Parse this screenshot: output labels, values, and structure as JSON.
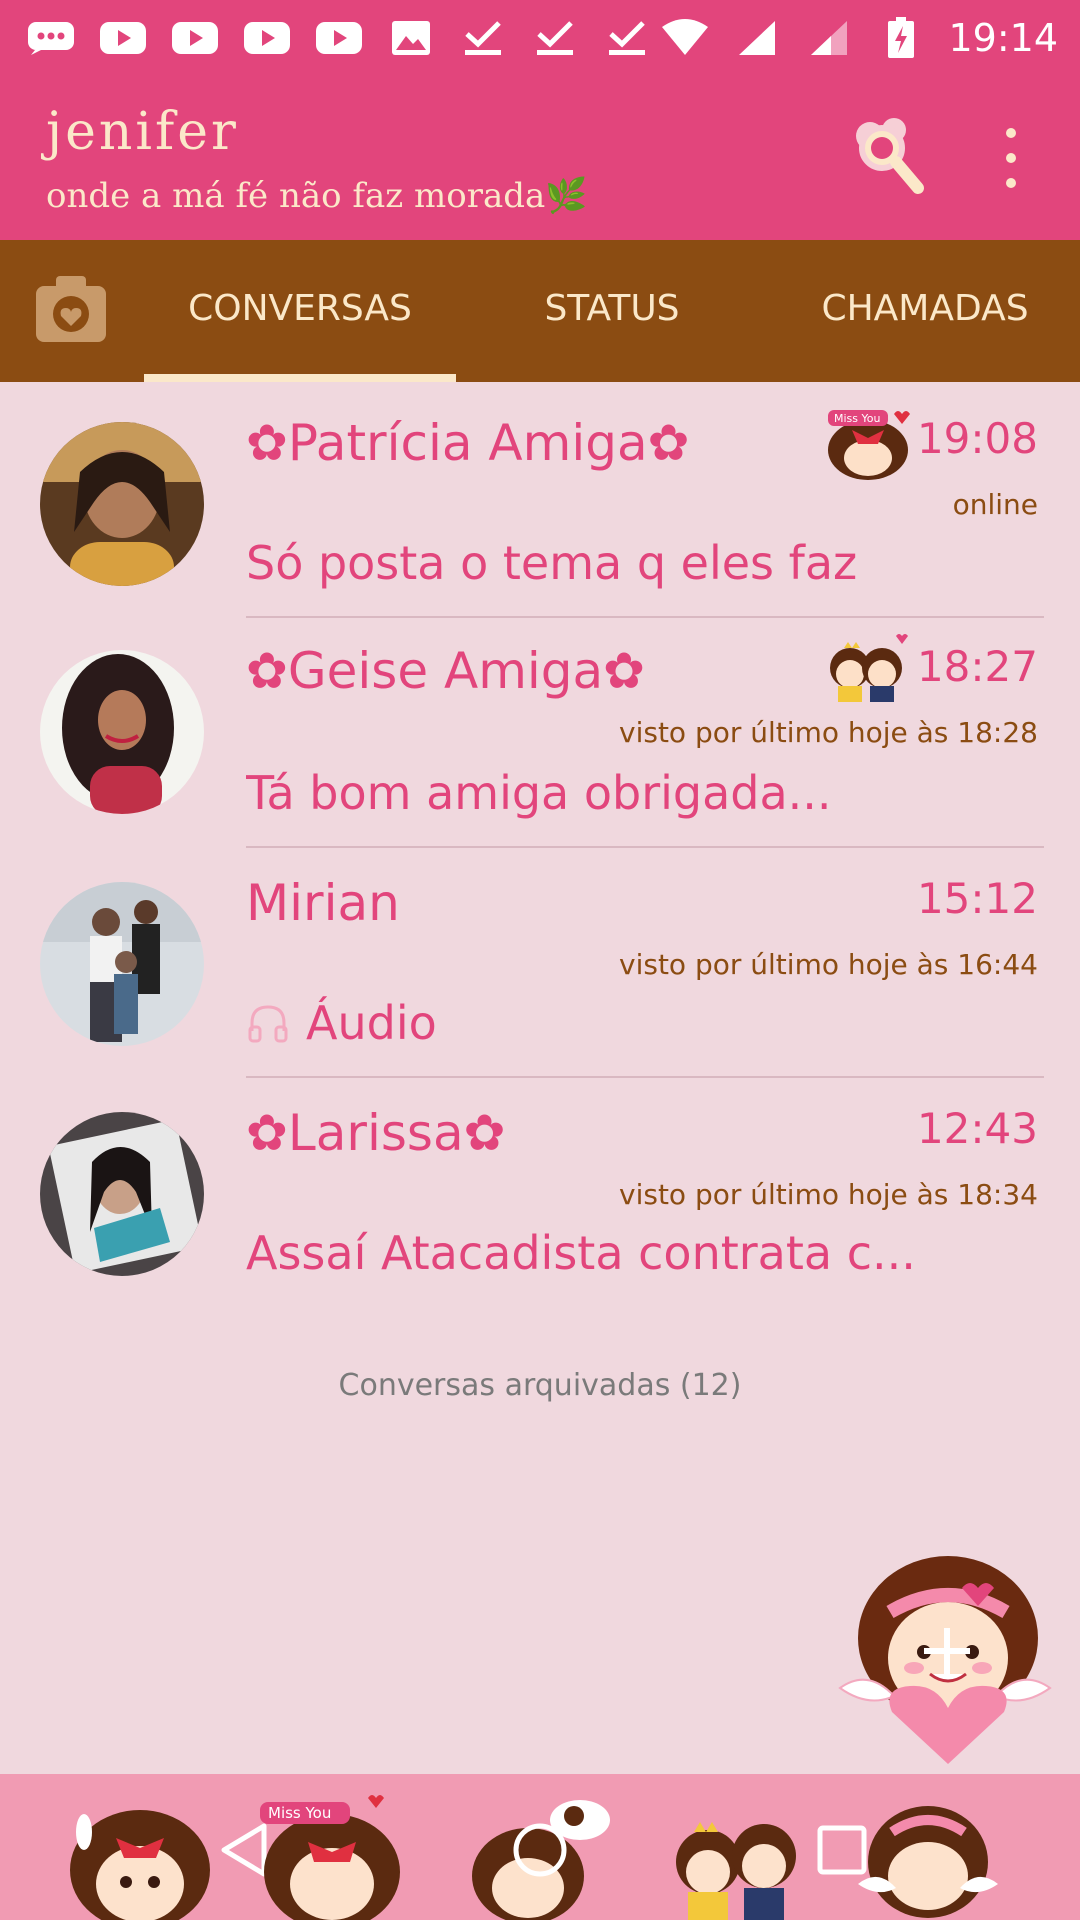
{
  "status_bar": {
    "time": "19:14",
    "icons": [
      "chat-bubble-icon",
      "youtube-icon",
      "youtube-icon",
      "youtube-icon",
      "youtube-icon",
      "image-icon",
      "check-icon",
      "check-icon",
      "check-icon",
      "wifi-icon",
      "signal-icon",
      "signal-icon",
      "battery-charging-icon"
    ]
  },
  "app_bar": {
    "title": "jenifer",
    "subtitle": "onde a má fé não faz morada"
  },
  "tabs": {
    "conversations": "CONVERSAS",
    "status": "STATUS",
    "calls": "CHAMADAS"
  },
  "chats": [
    {
      "name": "✿Patrícia Amiga✿",
      "time": "19:08",
      "status": "online",
      "message": "Só posta o tema q eles faz"
    },
    {
      "name": "✿Geise Amiga✿",
      "time": "18:27",
      "status": "visto por último hoje às 18:28",
      "message": "Tá bom amiga obrigada..."
    },
    {
      "name": "Mirian",
      "time": "15:12",
      "status": "visto por último hoje às 16:44",
      "message": "Áudio"
    },
    {
      "name": "✿Larissa✿",
      "time": "12:43",
      "status": "visto por último hoje às 18:34",
      "message": "Assaí Atacadista contrata c..."
    }
  ],
  "archived": "Conversas arquivadas (12)",
  "colors": {
    "accent": "#e2457c",
    "tab_bar": "#8b4c12",
    "background": "#f0d8de",
    "cream": "#fbe8c9",
    "nav_bar": "#f19bb3"
  }
}
